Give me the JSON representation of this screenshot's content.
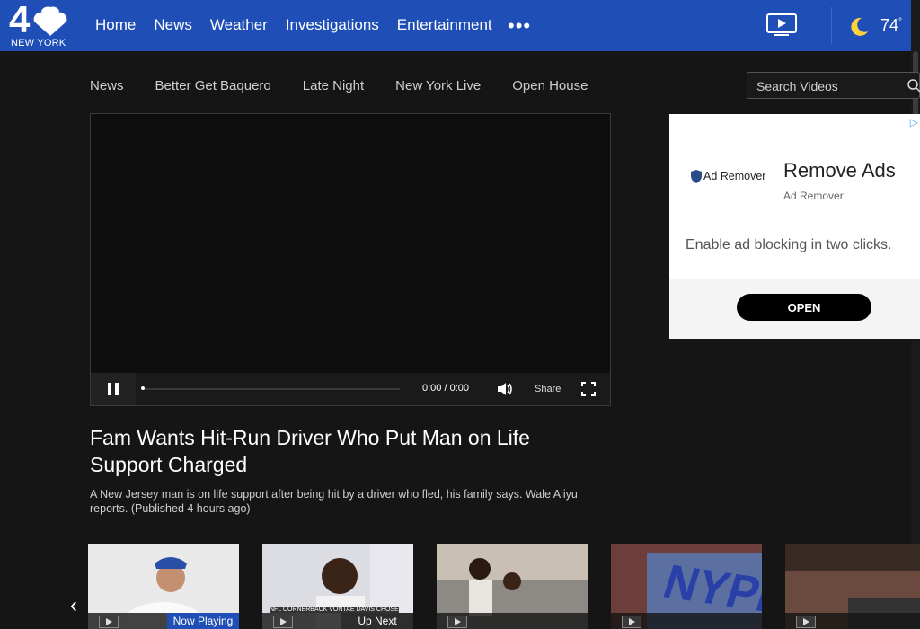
{
  "brand": {
    "logo_number": "4",
    "logo_city": "NEW YORK"
  },
  "nav": {
    "items": [
      "Home",
      "News",
      "Weather",
      "Investigations",
      "Entertainment"
    ],
    "more": "•••"
  },
  "weather": {
    "temperature": "74",
    "unit_mark": "°",
    "icon": "moon-icon"
  },
  "subnav": {
    "items": [
      "News",
      "Better Get Baquero",
      "Late Night",
      "New York Live",
      "Open House"
    ]
  },
  "search": {
    "placeholder": "Search Videos"
  },
  "player": {
    "time": "0:00 / 0:00",
    "share_label": "Share",
    "progress": 0
  },
  "video": {
    "headline": "Fam Wants Hit-Run Driver Who Put Man on Life Support Charged",
    "description": "A New Jersey man is on life support after being hit by a driver who fled, his family says. Wale Aliyu reports. (Published 4 hours ago)"
  },
  "ad": {
    "brand": "Ad Remover",
    "title": "Remove Ads",
    "subtitle": "Ad Remover",
    "body": "Enable ad blocking in two clicks.",
    "button": "OPEN"
  },
  "carousel": {
    "thumbs": [
      {
        "tag": "Now Playing",
        "caption": ""
      },
      {
        "tag": "Up Next",
        "caption": "NFL CORNERBACK VONTAE DAVIS CHOSE"
      },
      {
        "tag": "",
        "caption": ""
      },
      {
        "tag": "",
        "caption": "NYPD"
      },
      {
        "tag": "",
        "caption": ""
      }
    ]
  },
  "colors": {
    "brand_blue": "#1f4fb6",
    "background": "#151515"
  }
}
